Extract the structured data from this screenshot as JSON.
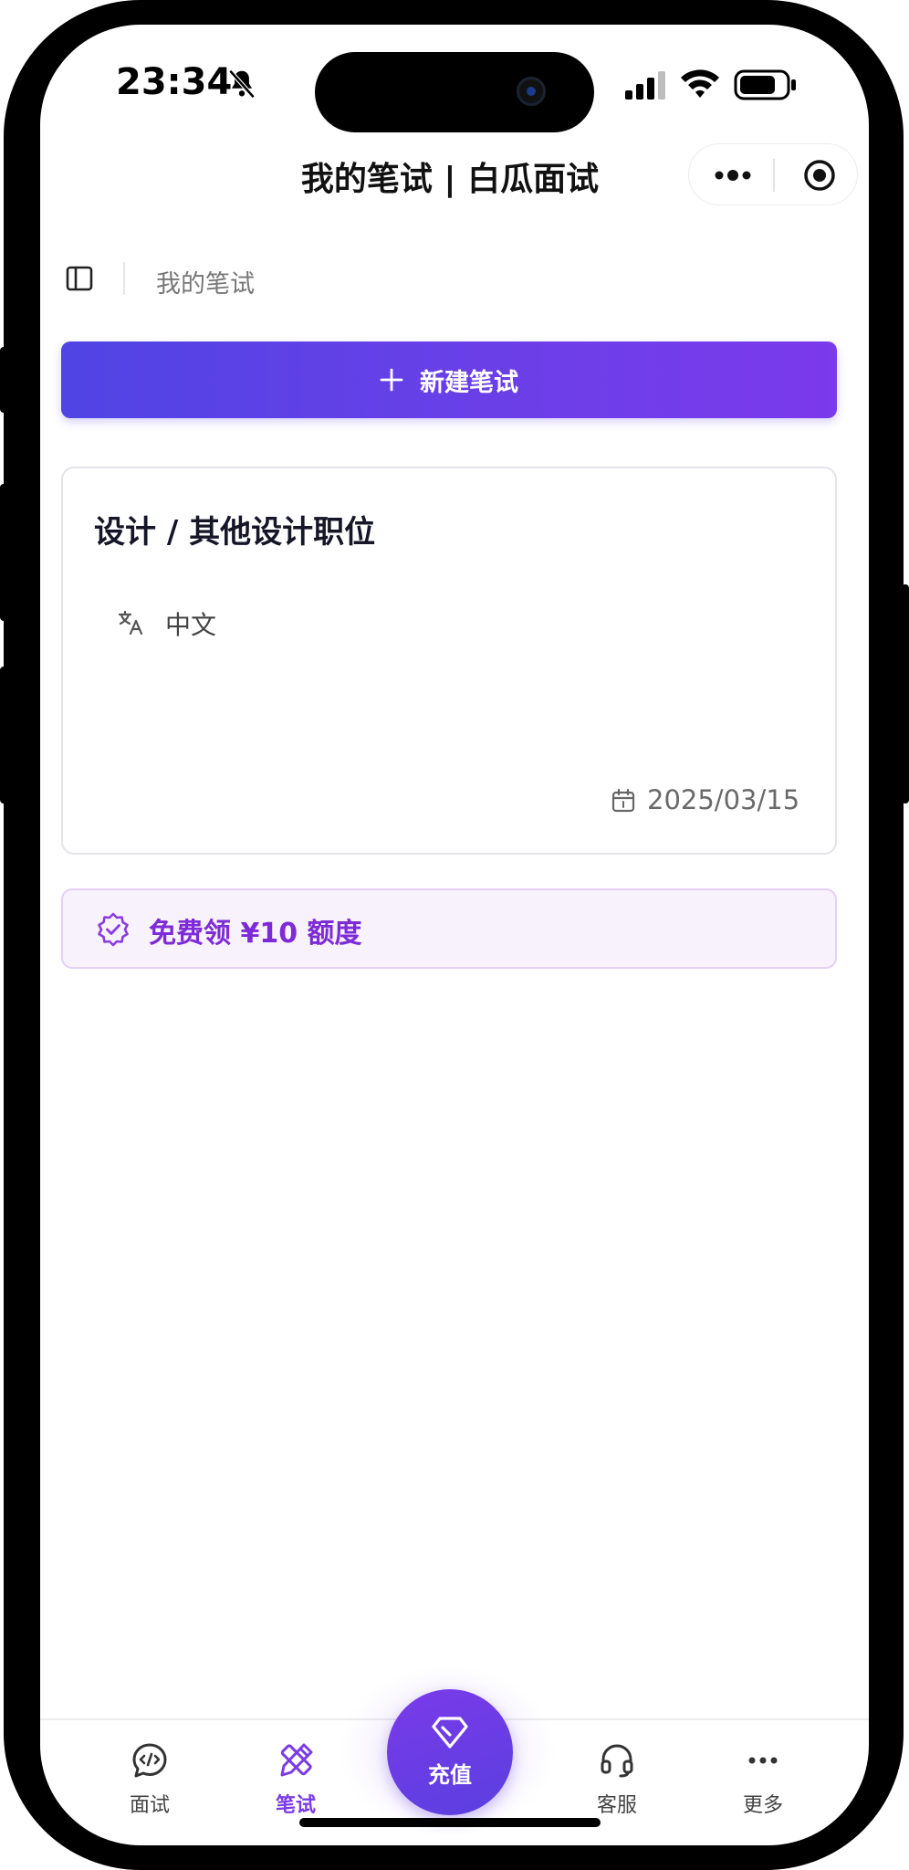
{
  "status_bar": {
    "time": "23:34"
  },
  "nav": {
    "title": "我的笔试 | 白瓜面试"
  },
  "breadcrumb": {
    "label": "我的笔试"
  },
  "new_button": {
    "label": "新建笔试"
  },
  "card": {
    "title": "设计 / 其他设计职位",
    "language": "中文",
    "date": "2025/03/15"
  },
  "promo": {
    "label": "免费领 ¥10 额度"
  },
  "tabbar": {
    "tabs": [
      {
        "label": "面试",
        "icon": "chat-bubble-icon",
        "active": false
      },
      {
        "label": "笔试",
        "icon": "pencil-ruler-icon",
        "active": true
      },
      {
        "label": "客服",
        "icon": "headset-icon",
        "active": false
      },
      {
        "label": "更多",
        "icon": "more-dots-icon",
        "active": false
      }
    ],
    "center_label": "充值",
    "center_icon": "diamond-icon"
  },
  "colors": {
    "accent": "#7a3ae8",
    "button_gradient_start": "#5044e4",
    "button_gradient_end": "#7b3aec",
    "promo_bg": "#f8f2fd",
    "promo_text": "#7d2bd6"
  }
}
